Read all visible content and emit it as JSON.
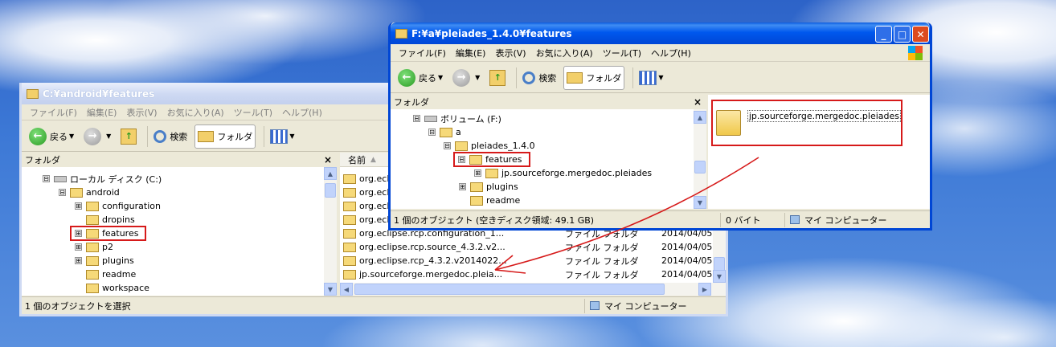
{
  "left_window": {
    "title": "C:¥android¥features",
    "menu": [
      "ファイル(F)",
      "編集(E)",
      "表示(V)",
      "お気に入り(A)",
      "ツール(T)",
      "ヘルプ(H)"
    ],
    "toolbar": {
      "back": "戻る",
      "search": "検索",
      "folders": "フォルダ"
    },
    "folders_pane": {
      "title": "フォルダ",
      "close": "×",
      "items": [
        {
          "expander": "⊟",
          "label": "ローカル ディスク (C:)"
        },
        {
          "expander": "⊟",
          "label": "android"
        },
        {
          "expander": "⊞",
          "label": "configuration"
        },
        {
          "expander": "",
          "label": "dropins"
        },
        {
          "expander": "⊞",
          "label": "features"
        },
        {
          "expander": "⊞",
          "label": "p2"
        },
        {
          "expander": "⊞",
          "label": "plugins"
        },
        {
          "expander": "",
          "label": "readme"
        },
        {
          "expander": "",
          "label": "workspace"
        }
      ]
    },
    "list": {
      "header_name": "名前",
      "rows": [
        {
          "name": "org.eclip",
          "type": "",
          "date": ""
        },
        {
          "name": "org.eclip",
          "type": "",
          "date": ""
        },
        {
          "name": "org.eclip",
          "type": "",
          "date": ""
        },
        {
          "name": "org.eclip",
          "type": "",
          "date": ""
        },
        {
          "name": "org.eclipse.rcp.configuration_1...",
          "type": "ファイル フォルダ",
          "date": "2014/04/05"
        },
        {
          "name": "org.eclipse.rcp.source_4.3.2.v2...",
          "type": "ファイル フォルダ",
          "date": "2014/04/05"
        },
        {
          "name": "org.eclipse.rcp_4.3.2.v2014022...",
          "type": "ファイル フォルダ",
          "date": "2014/04/05"
        },
        {
          "name": "jp.sourceforge.mergedoc.pleia...",
          "type": "ファイル フォルダ",
          "date": "2014/04/05"
        }
      ]
    },
    "status": {
      "left": "1 個のオブジェクトを選択",
      "right": "マイ コンピューター"
    }
  },
  "right_window": {
    "title": "F:¥a¥pleiades_1.4.0¥features",
    "menu": [
      "ファイル(F)",
      "編集(E)",
      "表示(V)",
      "お気に入り(A)",
      "ツール(T)",
      "ヘルプ(H)"
    ],
    "toolbar": {
      "back": "戻る",
      "search": "検索",
      "folders": "フォルダ"
    },
    "folders_pane": {
      "title": "フォルダ",
      "close": "×",
      "items": [
        {
          "expander": "⊟",
          "label": "ボリューム (F:)"
        },
        {
          "expander": "⊟",
          "label": "a"
        },
        {
          "expander": "⊟",
          "label": "pleiades_1.4.0"
        },
        {
          "expander": "⊟",
          "label": "features"
        },
        {
          "expander": "⊞",
          "label": "jp.sourceforge.mergedoc.pleiades"
        },
        {
          "expander": "⊞",
          "label": "plugins"
        },
        {
          "expander": "",
          "label": "readme"
        }
      ]
    },
    "content": {
      "folder_label": "jp.sourceforge.mergedoc.pleiades"
    },
    "status": {
      "left": "1 個のオブジェクト (空きディスク領域: 49.1 GB)",
      "middle": "0 バイト",
      "right": "マイ コンピューター"
    }
  },
  "colors": {
    "highlight": "#d61a1a",
    "title_active": "#0058ee",
    "desktop": "#3d79d6"
  }
}
